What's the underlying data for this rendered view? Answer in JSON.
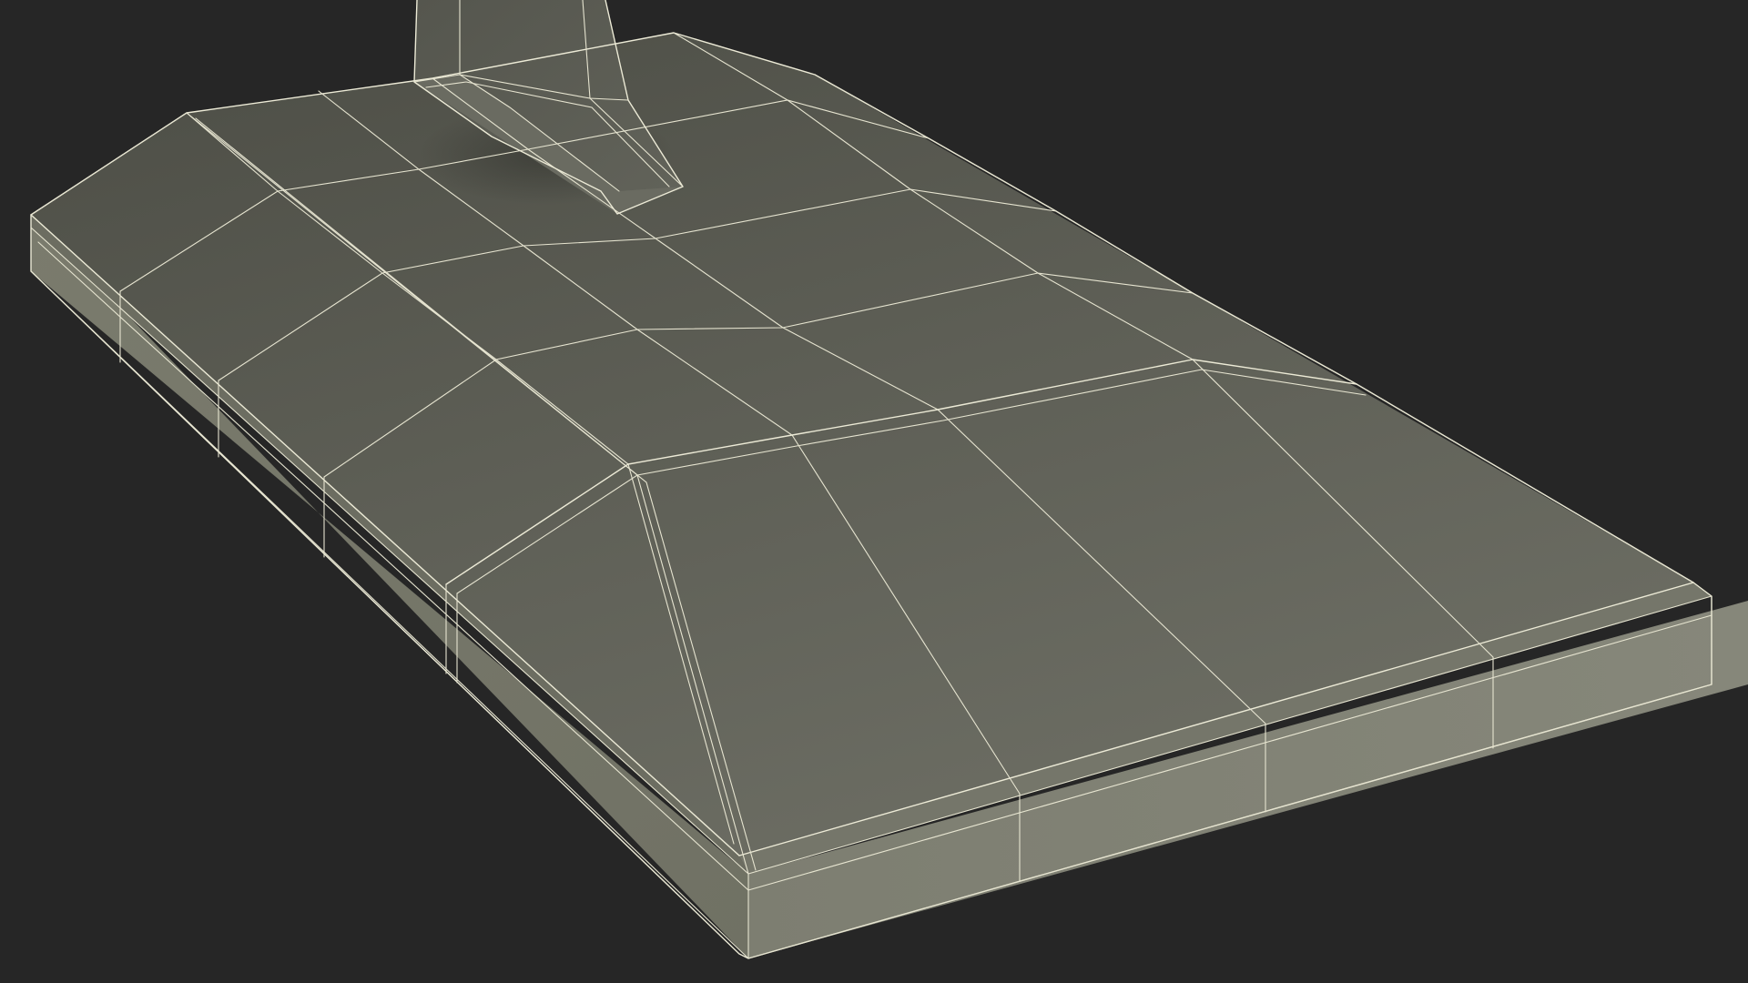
{
  "viewport": {
    "background_color": "#262626"
  },
  "model": {
    "subject": "monitor-stand-base",
    "render_mode": "wireframe-on-shaded",
    "colors": {
      "top_surface_light": "#6e7064",
      "top_surface_dark": "#4f5048",
      "front_side": "#7e7f72",
      "left_side": "#777869",
      "bevel": "#8a8b7d",
      "neck": "#5e5f56",
      "wireframe": "#ecead6"
    }
  }
}
